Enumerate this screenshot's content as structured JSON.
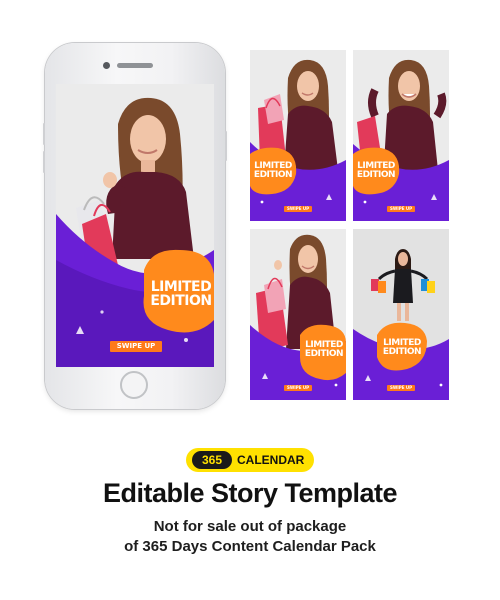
{
  "story": {
    "badge_line1": "LIMITED",
    "badge_line2": "EDITION",
    "swipe_label": "SWIPE UP"
  },
  "branding": {
    "badge_number": "365",
    "badge_word": "CALENDAR"
  },
  "headline": {
    "title": "Editable Story Template",
    "line1": "Not for sale out of package",
    "line2": "of 365 Days Content Calendar Pack"
  },
  "colors": {
    "purple": "#6a1fd6",
    "orange": "#ff8a1c",
    "yellow": "#ffe100",
    "sweater": "#5c1a2b"
  }
}
